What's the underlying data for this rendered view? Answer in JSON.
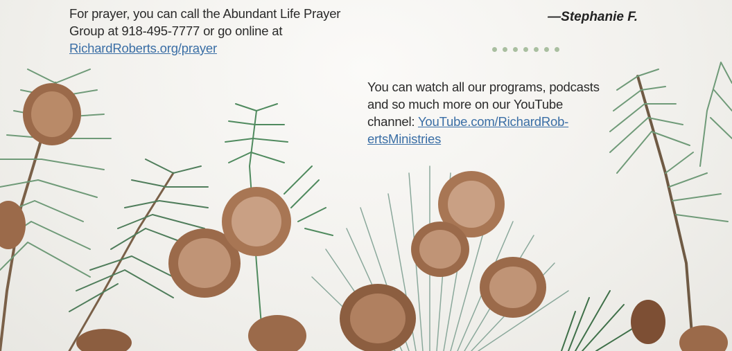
{
  "prayer": {
    "text": "For prayer, you can call the Abundant Life Prayer Group at 918-495-7777 or go online at ",
    "link": "RichardRoberts.org/prayer"
  },
  "attribution": {
    "dash": "—",
    "name": "Stephanie F."
  },
  "divider": {
    "dot_count": 7,
    "color": "#a9bfa0"
  },
  "youtube": {
    "text": "You can watch all our programs, podcasts and so much more on our YouTube channel: ",
    "link_part1": "YouTube.com/RichardRob-",
    "link_part2": "ertsMinistries"
  },
  "theme": {
    "link_color": "#3a6ea5",
    "pine_color": "#5e8a68",
    "cone_color": "#9b6a4a"
  }
}
